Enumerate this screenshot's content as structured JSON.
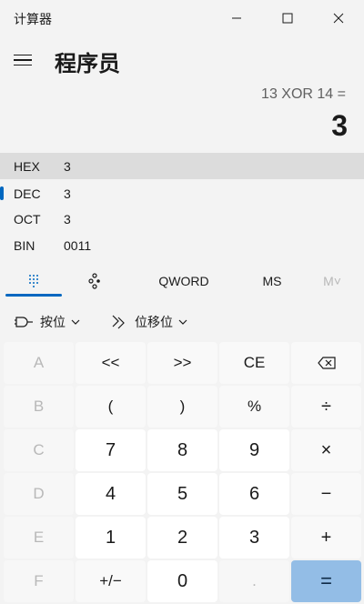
{
  "window": {
    "title": "计算器"
  },
  "header": {
    "mode_title": "程序员"
  },
  "display": {
    "expression": "13 XOR 14 =",
    "result": "3"
  },
  "radix": [
    {
      "label": "HEX",
      "value": "3"
    },
    {
      "label": "DEC",
      "value": "3"
    },
    {
      "label": "OCT",
      "value": "3"
    },
    {
      "label": "BIN",
      "value": "0011"
    }
  ],
  "tabs": {
    "word_size": "QWORD",
    "memory_store": "MS",
    "memory_recall": "M˅"
  },
  "dropdowns": {
    "bitwise": "按位",
    "bitshift": "位移位"
  },
  "keys": [
    [
      "A",
      "<<",
      ">>",
      "CE",
      "⌫"
    ],
    [
      "B",
      "(",
      ")",
      "%",
      "÷"
    ],
    [
      "C",
      "7",
      "8",
      "9",
      "×"
    ],
    [
      "D",
      "4",
      "5",
      "6",
      "−"
    ],
    [
      "E",
      "1",
      "2",
      "3",
      "+"
    ],
    [
      "F",
      "+/−",
      "0",
      ".",
      "="
    ]
  ],
  "colors": {
    "accent": "#0067c0",
    "equals_bg": "#93bde6",
    "background": "#f3f3f3"
  }
}
